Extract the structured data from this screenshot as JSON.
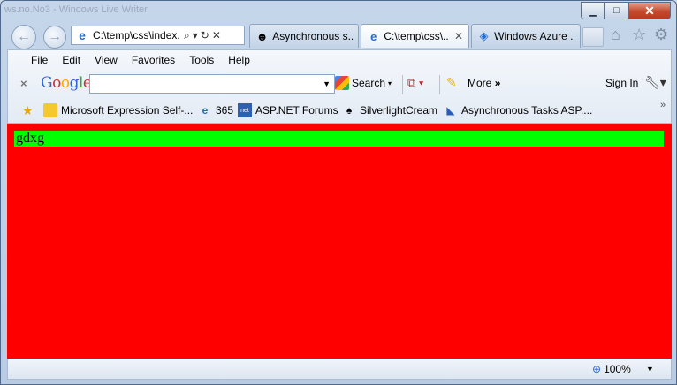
{
  "window": {
    "title": "ws.no.No3 - Windows Live Writer",
    "controls": {
      "minimize": "▁",
      "maximize": "□",
      "close": "✕"
    }
  },
  "nav": {
    "back_icon": "back-arrow-icon",
    "forward_icon": "forward-arrow-icon"
  },
  "address": {
    "url": "C:\\temp\\css\\index."
  },
  "tabs": [
    {
      "label": "Asynchronous s...",
      "icon": "person-avatar-icon",
      "active": false
    },
    {
      "label": "C:\\temp\\css\\...",
      "icon": "ie-page-icon",
      "active": true
    },
    {
      "label": "Windows Azure ...",
      "icon": "azure-icon",
      "active": false
    }
  ],
  "menu": [
    "File",
    "Edit",
    "View",
    "Favorites",
    "Tools",
    "Help"
  ],
  "google_toolbar": {
    "logo": [
      "G",
      "o",
      "o",
      "g",
      "l",
      "e"
    ],
    "search_value": "",
    "search_label": "Search",
    "more_label": "More",
    "more_chevron": "»",
    "sign_in_label": "Sign In"
  },
  "favorites": [
    {
      "label": "Microsoft Expression Self-...",
      "icon": "folder-icon"
    },
    {
      "label": "365",
      "icon": "ie-page-icon"
    },
    {
      "label": "ASP.NET Forums",
      "icon": "aspnet-icon"
    },
    {
      "label": "SilverlightCream",
      "icon": "spade-icon"
    },
    {
      "label": "Asynchronous Tasks ASP....",
      "icon": "web-slice-icon"
    }
  ],
  "content": {
    "text": "gdxg",
    "background": "#ff0000",
    "highlight": "#00ff00"
  },
  "status": {
    "zoom": "100%"
  }
}
